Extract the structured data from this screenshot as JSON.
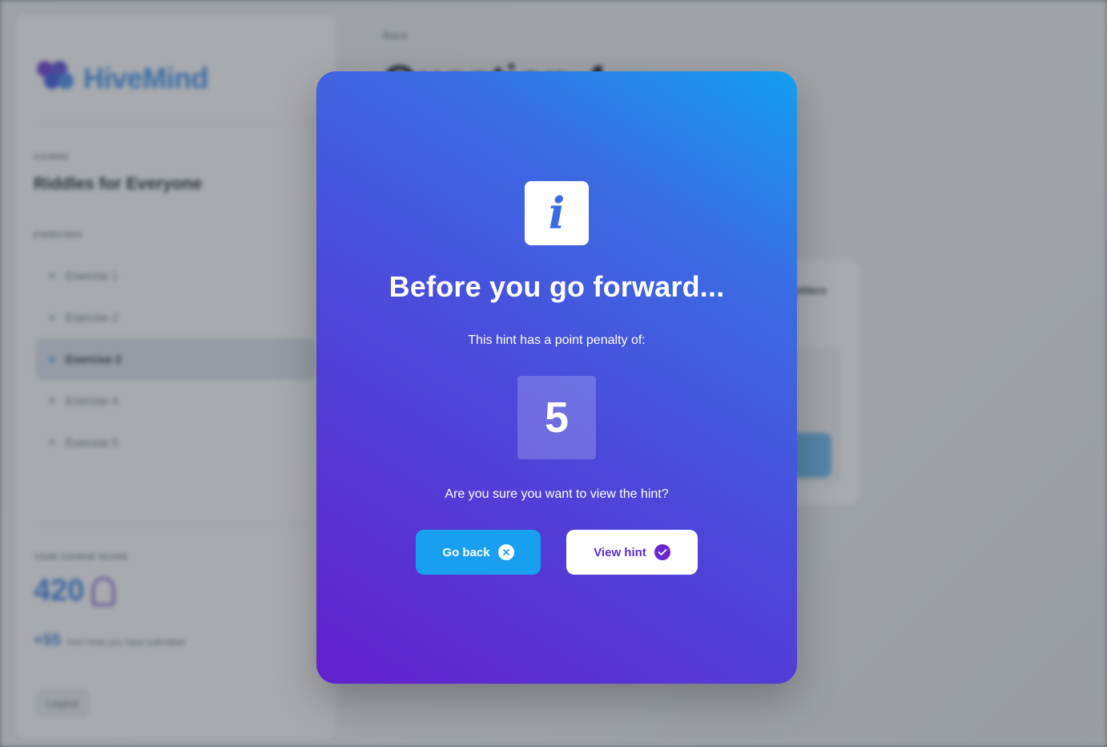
{
  "background": {
    "brand": "HiveMind",
    "course_label": "COURSE",
    "course_name": "Riddles for Everyone",
    "exercises_label": "EXERCISES",
    "exercises": [
      {
        "label": "Exercise 1",
        "active": false
      },
      {
        "label": "Exercise 2",
        "active": false
      },
      {
        "label": "Exercise 3",
        "active": true
      },
      {
        "label": "Exercise 4",
        "active": false
      },
      {
        "label": "Exercise 5",
        "active": false
      }
    ],
    "score_label": "YOUR COURSE SCORE",
    "score_value": "420",
    "score_extra_value": "+55",
    "score_extra_text": "from hints you have submitted",
    "logout_label": "Logout",
    "back_label": "Back",
    "page_title": "Question 4",
    "card_text": "letters"
  },
  "modal": {
    "icon": "info-icon",
    "title": "Before you go forward...",
    "subtitle": "This hint has a point penalty of:",
    "penalty": "5",
    "confirm_text": "Are you sure you want to view the hint?",
    "go_back_label": "Go back",
    "go_back_icon": "close-circle-icon",
    "view_hint_label": "View hint",
    "view_hint_icon": "check-circle-icon"
  },
  "colors": {
    "modal_gradient_start": "#139ef0",
    "modal_gradient_end": "#6320cd",
    "go_back_button": "#189ff0",
    "view_hint_text": "#5c2ad2"
  }
}
